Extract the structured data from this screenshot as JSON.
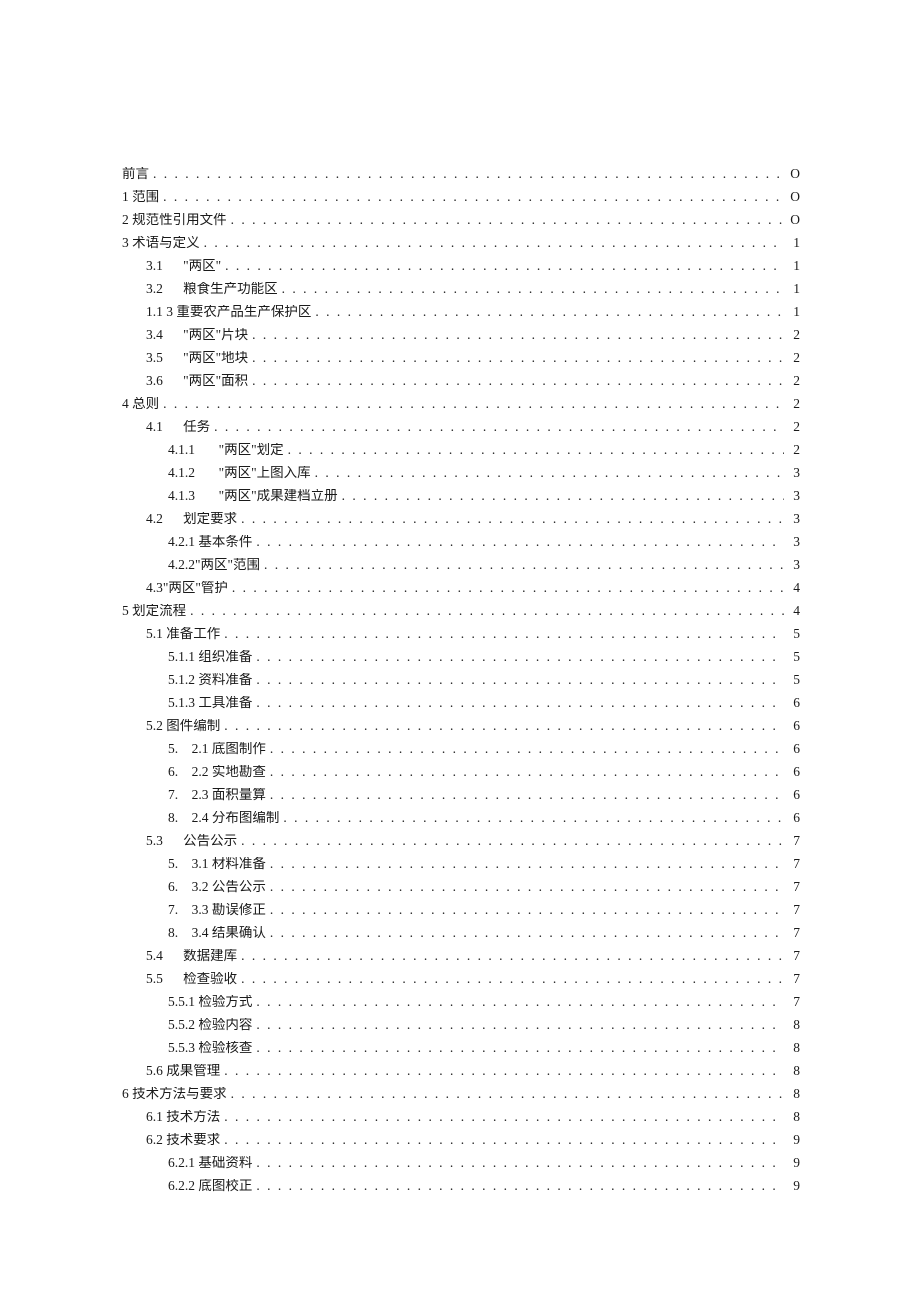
{
  "toc": [
    {
      "indent": 0,
      "label": "前言",
      "page": "O"
    },
    {
      "indent": 0,
      "label": "1 范围",
      "page": "O"
    },
    {
      "indent": 0,
      "label": "2 规范性引用文件",
      "page": "O"
    },
    {
      "indent": 0,
      "label": "3 术语与定义",
      "page": "1"
    },
    {
      "indent": 1,
      "label": "3.1      \"两区\"",
      "page": "1"
    },
    {
      "indent": 1,
      "label": "3.2      粮食生产功能区",
      "page": "1"
    },
    {
      "indent": 1,
      "label": "1.1 3 重要农产品生产保护区",
      "page": "1"
    },
    {
      "indent": 1,
      "label": "3.4      \"两区\"片块",
      "page": "2"
    },
    {
      "indent": 1,
      "label": "3.5      \"两区\"地块",
      "page": "2"
    },
    {
      "indent": 1,
      "label": "3.6      \"两区\"面积",
      "page": "2"
    },
    {
      "indent": 0,
      "label": "4 总则",
      "page": "2"
    },
    {
      "indent": 1,
      "label": "4.1      任务",
      "page": "2"
    },
    {
      "indent": 2,
      "label": "4.1.1       \"两区\"划定",
      "page": "2"
    },
    {
      "indent": 2,
      "label": "4.1.2       \"两区\"上图入库",
      "page": "3"
    },
    {
      "indent": 2,
      "label": "4.1.3       \"两区\"成果建档立册",
      "page": "3"
    },
    {
      "indent": 1,
      "label": "4.2      划定要求",
      "page": "3"
    },
    {
      "indent": 2,
      "label": "4.2.1 基本条件",
      "page": "3"
    },
    {
      "indent": 2,
      "label": "4.2.2\"两区\"范围",
      "page": "3"
    },
    {
      "indent": 1,
      "label": "4.3\"两区\"管护",
      "page": "4"
    },
    {
      "indent": 0,
      "label": "5 划定流程",
      "page": "4"
    },
    {
      "indent": 1,
      "label": "5.1 准备工作",
      "page": "5"
    },
    {
      "indent": 2,
      "label": "5.1.1 组织准备",
      "page": "5"
    },
    {
      "indent": 2,
      "label": "5.1.2 资料准备",
      "page": "5"
    },
    {
      "indent": 2,
      "label": "5.1.3 工具准备",
      "page": "6"
    },
    {
      "indent": 1,
      "label": "5.2 图件编制",
      "page": "6"
    },
    {
      "indent": 2,
      "label": "5.    2.1 底图制作",
      "page": "6"
    },
    {
      "indent": 2,
      "label": "6.    2.2 实地勘查",
      "page": "6"
    },
    {
      "indent": 2,
      "label": "7.    2.3 面积量算",
      "page": "6"
    },
    {
      "indent": 2,
      "label": "8.    2.4 分布图编制",
      "page": "6"
    },
    {
      "indent": 1,
      "label": "5.3      公告公示",
      "page": "7"
    },
    {
      "indent": 2,
      "label": "5.    3.1 材料准备",
      "page": "7"
    },
    {
      "indent": 2,
      "label": "6.    3.2 公告公示",
      "page": "7"
    },
    {
      "indent": 2,
      "label": "7.    3.3 勘误修正",
      "page": "7"
    },
    {
      "indent": 2,
      "label": "8.    3.4 结果确认",
      "page": "7"
    },
    {
      "indent": 1,
      "label": "5.4      数据建库",
      "page": "7"
    },
    {
      "indent": 1,
      "label": "5.5      检查验收",
      "page": "7"
    },
    {
      "indent": 2,
      "label": "5.5.1 检验方式",
      "page": "7"
    },
    {
      "indent": 2,
      "label": "5.5.2 检验内容",
      "page": "8"
    },
    {
      "indent": 2,
      "label": "5.5.3 检验核查",
      "page": "8"
    },
    {
      "indent": 1,
      "label": "5.6 成果管理",
      "page": "8"
    },
    {
      "indent": 0,
      "label": "6 技术方法与要求",
      "page": "8"
    },
    {
      "indent": 1,
      "label": "6.1 技术方法",
      "page": "8"
    },
    {
      "indent": 1,
      "label": "6.2 技术要求",
      "page": "9"
    },
    {
      "indent": 2,
      "label": "6.2.1 基础资料",
      "page": "9"
    },
    {
      "indent": 2,
      "label": "6.2.2 底图校正",
      "page": "9"
    }
  ]
}
